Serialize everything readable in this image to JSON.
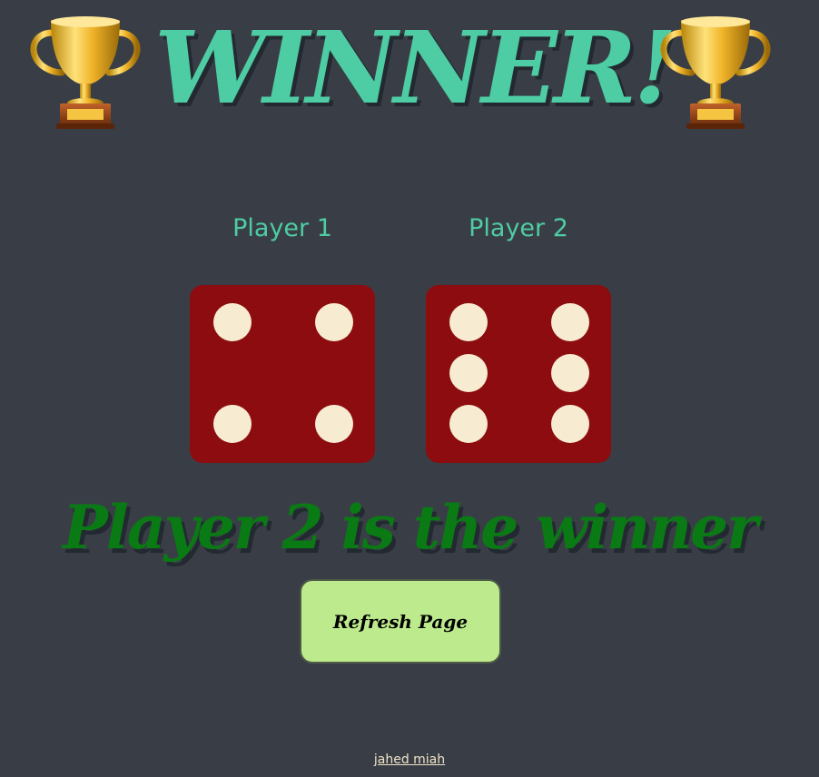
{
  "header": {
    "title": "WINNER!",
    "left_icon": "trophy-icon",
    "right_icon": "trophy-icon"
  },
  "players": [
    {
      "label": "Player 1",
      "die_value": 4
    },
    {
      "label": "Player 2",
      "die_value": 6
    }
  ],
  "result": {
    "text": "Player 2 is the winner"
  },
  "refresh_button": {
    "label": "Refresh Page"
  },
  "footer": {
    "credit": "jahed miah"
  },
  "colors": {
    "background": "#393e46",
    "title": "#4ecca3",
    "player_label": "#4ecca3",
    "die_face": "#8c0c0f",
    "die_pip": "#f7ecd1",
    "winner_text": "#0a7a14",
    "button": "#bdea8c"
  }
}
